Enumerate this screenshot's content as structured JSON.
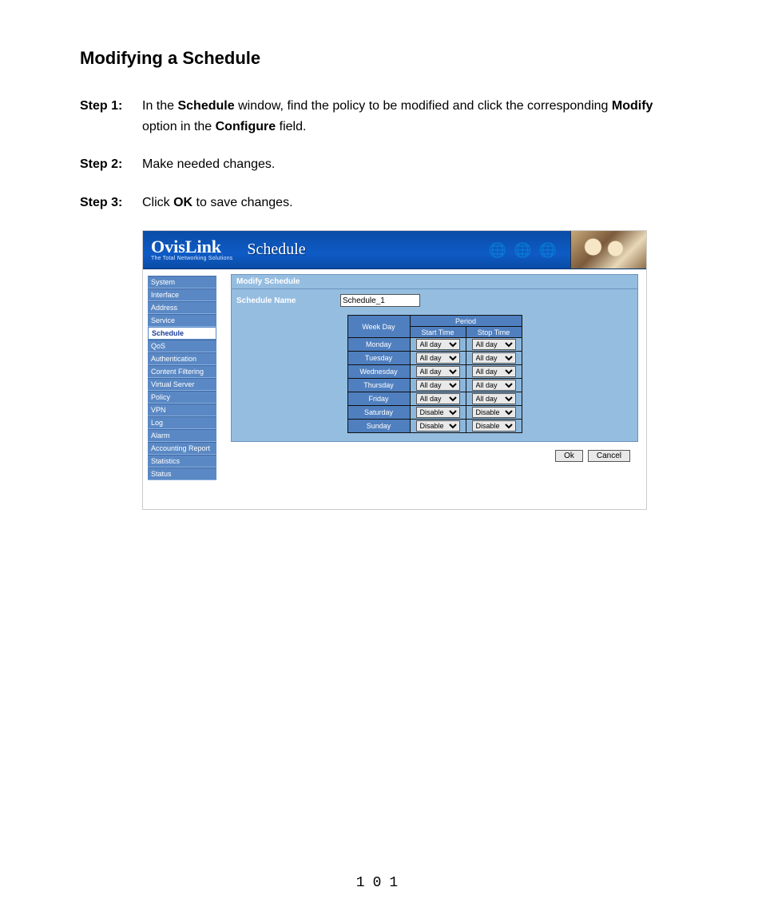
{
  "doc": {
    "title": "Modifying a Schedule",
    "step1_label": "Step 1:",
    "step1_part1": "In the ",
    "step1_bold1": "Schedule",
    "step1_part2": " window, find the policy to be modified and click the corresponding ",
    "step1_bold2": "Modify",
    "step1_part3": " option in the ",
    "step1_bold3": "Configure",
    "step1_part4": " field.",
    "step2_label": "Step 2:",
    "step2_text": "Make needed changes.",
    "step3_label": "Step 3:",
    "step3_part1": "Click ",
    "step3_bold1": "OK",
    "step3_part2": " to save changes.",
    "page_number": "101"
  },
  "banner": {
    "logo": "OvisLink",
    "logo_sub": "The Total Networking Solutions",
    "section": "Schedule"
  },
  "sidebar": {
    "items": [
      {
        "label": "System"
      },
      {
        "label": "Interface"
      },
      {
        "label": "Address"
      },
      {
        "label": "Service"
      },
      {
        "label": "Schedule",
        "active": true
      },
      {
        "label": "QoS"
      },
      {
        "label": "Authentication"
      },
      {
        "label": "Content Filtering"
      },
      {
        "label": "Virtual Server"
      },
      {
        "label": "Policy"
      },
      {
        "label": "VPN"
      },
      {
        "label": "Log"
      },
      {
        "label": "Alarm"
      },
      {
        "label": "Accounting Report"
      },
      {
        "label": "Statistics"
      },
      {
        "label": "Status"
      }
    ]
  },
  "panel": {
    "header": "Modify Schedule",
    "name_label": "Schedule Name",
    "name_value": "Schedule_1",
    "col_weekday": "Week Day",
    "col_period": "Period",
    "col_start": "Start Time",
    "col_stop": "Stop Time",
    "rows": [
      {
        "day": "Monday",
        "start": "All day",
        "stop": "All day"
      },
      {
        "day": "Tuesday",
        "start": "All day",
        "stop": "All day"
      },
      {
        "day": "Wednesday",
        "start": "All day",
        "stop": "All day"
      },
      {
        "day": "Thursday",
        "start": "All day",
        "stop": "All day"
      },
      {
        "day": "Friday",
        "start": "All day",
        "stop": "All day"
      },
      {
        "day": "Saturday",
        "start": "Disable",
        "stop": "Disable"
      },
      {
        "day": "Sunday",
        "start": "Disable",
        "stop": "Disable"
      }
    ],
    "ok": "Ok",
    "cancel": "Cancel"
  }
}
